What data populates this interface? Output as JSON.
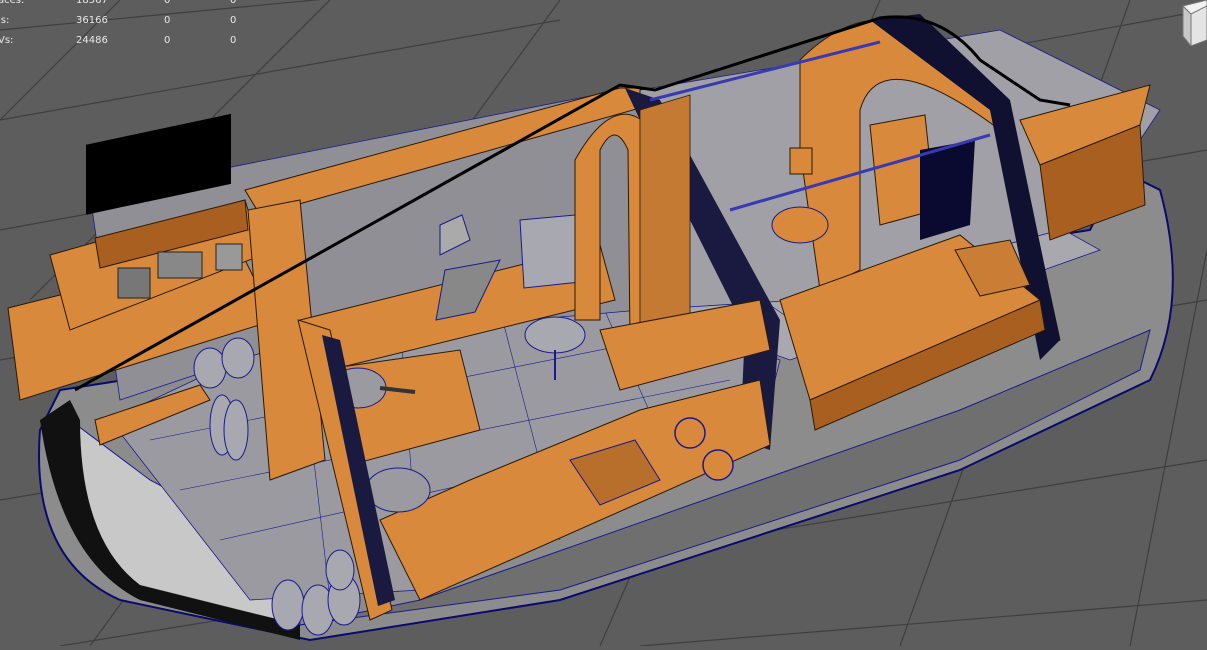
{
  "hud": {
    "rows": [
      {
        "label": "aces:",
        "values": [
          "18567",
          "0",
          "0"
        ]
      },
      {
        "label": "is:",
        "values": [
          "36166",
          "0",
          "0"
        ]
      },
      {
        "label": "Vs:",
        "values": [
          "24486",
          "0",
          "0"
        ]
      }
    ]
  },
  "colors": {
    "background": "#5d5d5d",
    "grid_line": "#3c3c3c",
    "wireframe": "#1a1a8c",
    "orange": "#d8893c",
    "orange_dark": "#a95f1f",
    "hull_gray": "#8a8a8a",
    "hull_light": "#b8b8b8"
  },
  "viewcube_icon": "viewcube-icon"
}
